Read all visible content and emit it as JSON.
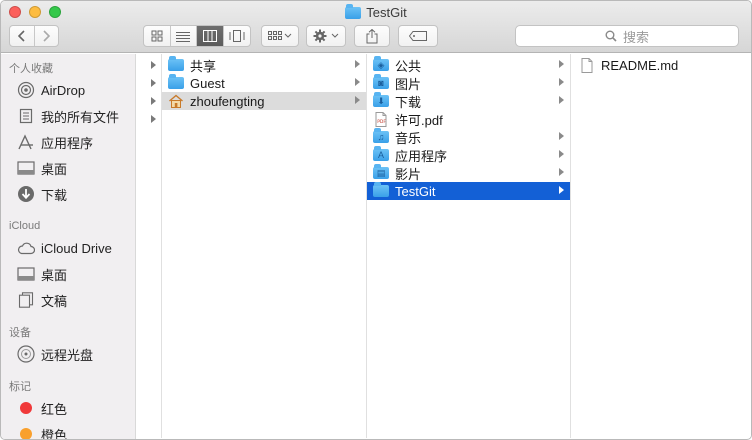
{
  "window": {
    "title": "TestGit",
    "search_placeholder": "搜索"
  },
  "sidebar": {
    "sections": [
      {
        "label": "个人收藏"
      },
      {
        "label": "iCloud"
      },
      {
        "label": "设备"
      },
      {
        "label": "标记"
      }
    ],
    "favorites": [
      {
        "label": "AirDrop",
        "icon": "airdrop-icon"
      },
      {
        "label": "我的所有文件",
        "icon": "all-files-icon"
      },
      {
        "label": "应用程序",
        "icon": "applications-icon"
      },
      {
        "label": "桌面",
        "icon": "desktop-icon"
      },
      {
        "label": "下载",
        "icon": "downloads-icon"
      }
    ],
    "icloud": [
      {
        "label": "iCloud Drive",
        "icon": "cloud-icon"
      },
      {
        "label": "桌面",
        "icon": "desktop-icon"
      },
      {
        "label": "文稿",
        "icon": "documents-icon"
      }
    ],
    "devices": [
      {
        "label": "远程光盘",
        "icon": "disc-icon"
      }
    ],
    "tags": [
      {
        "label": "红色",
        "color": "#f0393a"
      },
      {
        "label": "橙色",
        "color": "#f9a02d"
      }
    ]
  },
  "columns": {
    "col2": [
      {
        "label": "共享"
      },
      {
        "label": "Guest"
      },
      {
        "label": "zhoufengting"
      }
    ],
    "col3": [
      {
        "label": "公共",
        "glyph": "◈"
      },
      {
        "label": "图片",
        "glyph": "◙"
      },
      {
        "label": "下载",
        "glyph": "⬇"
      },
      {
        "label": "许可.pdf"
      },
      {
        "label": "音乐",
        "glyph": "♫"
      },
      {
        "label": "应用程序",
        "glyph": "A"
      },
      {
        "label": "影片",
        "glyph": "▤"
      },
      {
        "label": "TestGit"
      }
    ],
    "col4": [
      {
        "label": "README.md"
      }
    ]
  },
  "colors": {
    "selection_blue": "#1360d6",
    "selection_gray": "#dcdcdc",
    "folder_blue": "#4aaaf0"
  }
}
